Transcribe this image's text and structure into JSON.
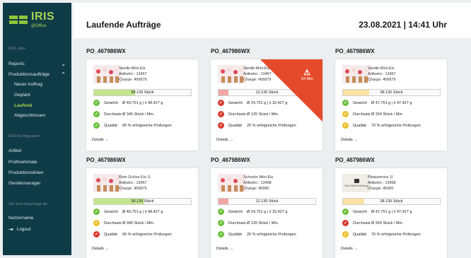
{
  "colors": {
    "sidebar": "#0f3b46",
    "accent": "#a6d653",
    "ok": "#6cbf3b",
    "warn": "#f0c02d",
    "error": "#d73a2d",
    "alert": "#e54b2a",
    "bar_green": "#c4e58f",
    "bar_red": "#f3a6a6",
    "bar_yellow": "#fbe3a4"
  },
  "sidebar": {
    "logo": {
      "title": "IRIS",
      "subtitle": "@Office"
    },
    "section_jobs": "IRIS Jobs",
    "reports": "Reports",
    "production_orders": "Produktionsaufträge",
    "new_order": "Neuer Auftrag",
    "planned": "Geplant",
    "running": "Laufend",
    "finished": "Abgeschlossen",
    "section_config": "IRIS Konfiguration",
    "articles": "Artikel",
    "features": "Prüfmerkmale",
    "lines": "Produktionslinien",
    "devices": "Gerätemanager",
    "logged_in_as": "Sie sind eingeloggt als",
    "username": "Nutzername",
    "logout": "Logout"
  },
  "header": {
    "title": "Laufende Aufträge",
    "datetime": "23.08.2021 | 14:41 Uhr"
  },
  "cards": [
    {
      "order": "PO_467986WX",
      "image": "ice-cream-product",
      "product": "Vanille-Mini-Eis",
      "article": "Artikelnr.: 13467",
      "batch": "Charge: 456879",
      "qty": "58.135 Stück",
      "progress": 0.42,
      "bar_color": "#c4e58f",
      "metrics": [
        {
          "label": "Gewicht",
          "value": "Ø 49,751 g | x̄ 48,427 g",
          "status": "ok"
        },
        {
          "label": "Durchsatz",
          "value": "Ø 345 Stück / Min.",
          "status": "ok"
        },
        {
          "label": "Qualität",
          "value": "90 % erfolgreiche Prüfungen",
          "status": "ok"
        }
      ],
      "details": "Details →"
    },
    {
      "order": "PO_467986WX",
      "image": "ice-cream-product",
      "product": "Vanille-Mini-Eis",
      "article": "Artikelnr.: 13467",
      "batch": "Charge: 456879",
      "qty": "12.135 Stück",
      "progress": 0.1,
      "bar_color": "#f3a6a6",
      "alert": {
        "icon": "⚠",
        "text": "54 Min."
      },
      "metrics": [
        {
          "label": "Gewicht",
          "value": "Ø 24,751 g | x̄ 32,427 g",
          "status": "error"
        },
        {
          "label": "Durchsatz",
          "value": "Ø 120 Stück / Min.",
          "status": "error"
        },
        {
          "label": "Qualität",
          "value": "20 % erfolgreiche Prüfungen",
          "status": "error"
        }
      ],
      "details": "Details →"
    },
    {
      "order": "PO_467986WX",
      "image": "ice-cream-product",
      "product": "Vanille-Mini-Eis",
      "article": "Artikelnr.: 13467",
      "batch": "Charge: 456879",
      "qty": "38.135 Stück",
      "progress": 0.27,
      "bar_color": "#fbe3a4",
      "metrics": [
        {
          "label": "Gewicht",
          "value": "Ø 47,751 g | x̄ 47,427 g",
          "status": "ok"
        },
        {
          "label": "Durchsatz",
          "value": "Ø 324 Stück / Min.",
          "status": "warn"
        },
        {
          "label": "Qualität",
          "value": "70 % erfolgreiche Prüfungen",
          "status": "warn"
        }
      ],
      "details": "Details →"
    },
    {
      "order": "PO_467986WX",
      "image": "ice-cream-product",
      "product": "Rote Grütze Eis 1l",
      "article": "Artikelnr.: 13467",
      "batch": "Charge: 456879",
      "qty": "58.135 Stück",
      "progress": 0.52,
      "bar_color": "#c4e58f",
      "metrics": [
        {
          "label": "Gewicht",
          "value": "Ø 49,751 g | x̄ 48,427 g",
          "status": "ok"
        },
        {
          "label": "Durchsatz",
          "value": "Ø 345 Stück / Min.",
          "status": "warn"
        },
        {
          "label": "Qualität",
          "value": "90 % erfolgreiche Prüfungen",
          "status": "error"
        }
      ],
      "details": "Details →"
    },
    {
      "order": "PO_467986WX",
      "image": "ice-cream-product",
      "product": "Schocko Mini-Eis",
      "article": "Artikelnr.: 13468",
      "batch": "Charge: 45680",
      "qty": "12.135 Stück",
      "progress": 0.1,
      "bar_color": "#f3a6a6",
      "metrics": [
        {
          "label": "Gewicht",
          "value": "Ø 24,751 g | x̄ 32,427 g",
          "status": "ok"
        },
        {
          "label": "Durchsatz",
          "value": "Ø 120 Stück / Min.",
          "status": "ok"
        },
        {
          "label": "Qualität",
          "value": "20 % erfolgreiche Prüfungen",
          "status": "ok"
        }
      ],
      "details": "Details →"
    },
    {
      "order": "PO_467986WX",
      "image": "no-image",
      "image_text": "Kein Bild hinterlegt",
      "product": "Pistazieneis 1l",
      "article": "Artikelnr.: 13468",
      "batch": "Charge: 45680",
      "qty": "38.135 Stück",
      "progress": 0.22,
      "bar_color": "#fbe3a4",
      "metrics": [
        {
          "label": "Gewicht",
          "value": "Ø 47,751 g | x̄ 47,427 g",
          "status": "ok"
        },
        {
          "label": "Durchsatz",
          "value": "Ø 324 Stück / Min.",
          "status": "error"
        },
        {
          "label": "Qualität",
          "value": "70 % erfolgreiche Prüfungen",
          "status": "warn"
        }
      ],
      "details": "Details →"
    }
  ]
}
